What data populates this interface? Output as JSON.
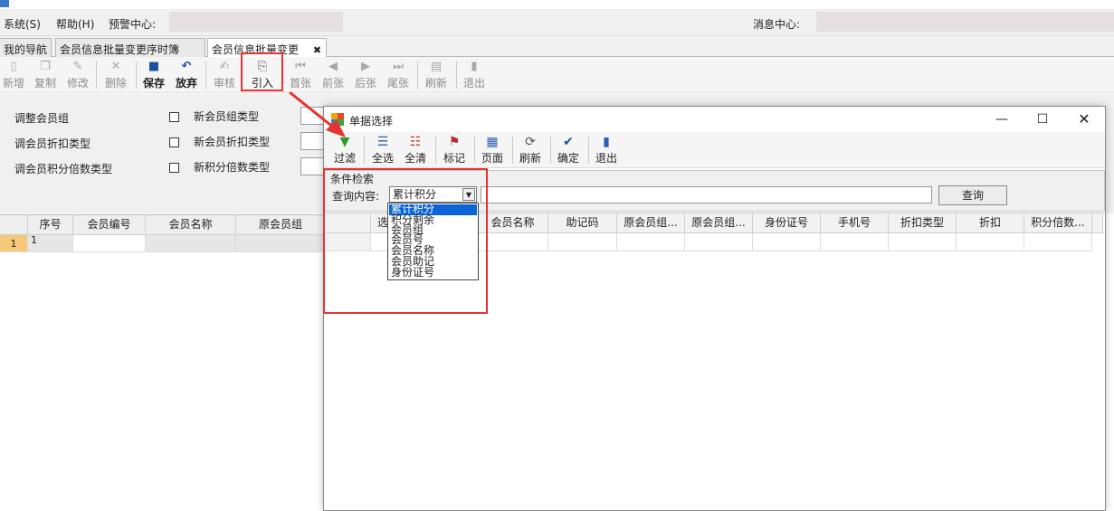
{
  "menubar": {
    "system": "系统(S)",
    "help": "帮助(H)",
    "alert_center": "预警中心:",
    "message_center": "消息中心:"
  },
  "tabs": [
    {
      "label": "我的导航"
    },
    {
      "label": "会员信息批量变更序时簿"
    },
    {
      "label": "会员信息批量变更",
      "close": "✖"
    }
  ],
  "toolbar": {
    "new": "新增",
    "copy": "复制",
    "edit": "修改",
    "delete": "删除",
    "save": "保存",
    "discard": "放弃",
    "audit": "审核",
    "import": "引入",
    "first": "首张",
    "prev": "前张",
    "next": "后张",
    "last": "尾张",
    "refresh": "刷新",
    "exit": "退出"
  },
  "form": {
    "adjust_group": "调整会员组",
    "adjust_discount": "调会员折扣类型",
    "adjust_points": "调会员积分倍数类型",
    "new_group": "新会员组类型",
    "new_discount": "新会员折扣类型",
    "new_points": "新积分倍数类型"
  },
  "main_grid": {
    "columns": [
      "序号",
      "会员编号",
      "会员名称",
      "原会员组"
    ],
    "row_number": "1",
    "row_index": "1"
  },
  "dialog": {
    "title": "单据选择",
    "toolbar": {
      "filter": "过滤",
      "select_all": "全选",
      "clear_all": "全清",
      "mark": "标记",
      "page": "页面",
      "refresh": "刷新",
      "confirm": "确定",
      "exit": "退出"
    },
    "search": {
      "group_title": "条件检索",
      "query_label": "查询内容:",
      "selected_field": "累计积分",
      "query_button": "查询"
    },
    "grid_columns": [
      "选",
      "会员名称",
      "助记码",
      "原会员组...",
      "原会员组...",
      "身份证号",
      "手机号",
      "折扣类型",
      "折扣",
      "积分倍数..."
    ],
    "dropdown_options": [
      "累计积分",
      "积分剩余",
      "会员组",
      "会员号",
      "会员名称",
      "会员助记",
      "身份证号"
    ]
  },
  "colors": {
    "annotation_red": "#e53333",
    "selection_blue": "#0a64d6"
  }
}
